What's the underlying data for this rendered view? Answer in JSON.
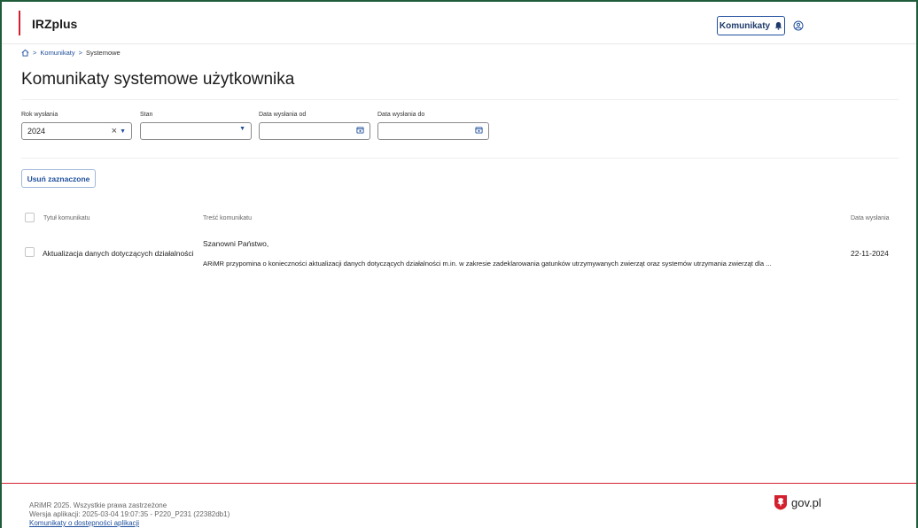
{
  "header": {
    "brand": "IRZplus",
    "messages_button": "Komunikaty",
    "icons": {
      "bell": "bell-icon",
      "user": "user-circle-icon"
    }
  },
  "breadcrumb": {
    "home_icon": "home-icon",
    "items": [
      "Komunikaty",
      "Systemowe"
    ],
    "separator": ">"
  },
  "page": {
    "title": "Komunikaty systemowe użytkownika"
  },
  "filters": {
    "year": {
      "label": "Rok wysłania",
      "value": "2024"
    },
    "state": {
      "label": "Stan",
      "value": ""
    },
    "date_from": {
      "label": "Data wysłania od",
      "value": ""
    },
    "date_to": {
      "label": "Data wysłania do",
      "value": ""
    }
  },
  "actions": {
    "delete_selected": "Usuń zaznaczone"
  },
  "table": {
    "columns": [
      "Tytuł komunikatu",
      "Treść komunikatu",
      "Data wysłania"
    ],
    "rows": [
      {
        "title": "Aktualizacja danych dotyczących działalności",
        "content_greeting": "Szanowni Państwo,",
        "content": "ARiMR przypomina o konieczności aktualizacji danych dotyczących działalności m.in. w zakresie zadeklarowania gatunków utrzymywanych zwierząt oraz systemów utrzymania zwierząt dla ...",
        "date": "22-11-2024"
      }
    ]
  },
  "footer": {
    "copyright": "ARiMR 2025. Wszystkie prawa zastrzeżone",
    "version": "Wersja aplikacji: 2025-03-04 19:07:35 - P220_P231 (22382db1)",
    "accessibility_link": "Komunikaty o dostępności aplikacji",
    "gov_logo": "gov.pl"
  },
  "colors": {
    "accent_blue": "#1f4f9c",
    "brand_red": "#d4202e",
    "frame_green": "#1f5c3a"
  }
}
